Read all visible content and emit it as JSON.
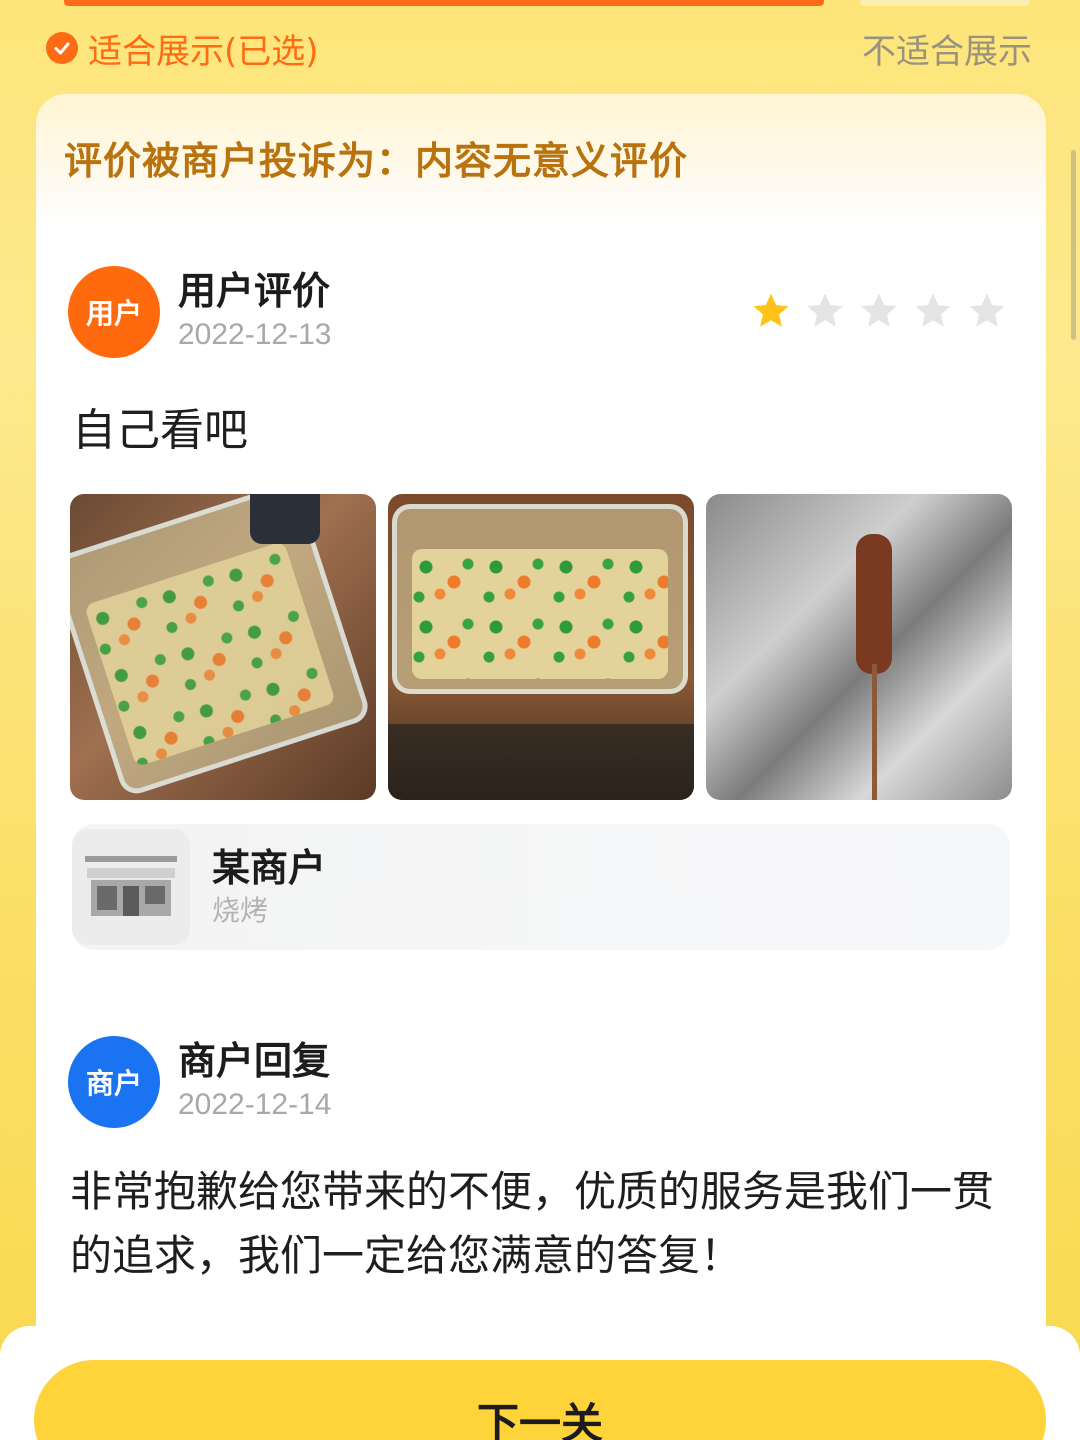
{
  "header": {
    "option_selected": "适合展示(已选)",
    "option_other": "不适合展示"
  },
  "card": {
    "complaint": "评价被商户投诉为：内容无意义评价",
    "user_review": {
      "avatar_label": "用户",
      "title": "用户评价",
      "date": "2022-12-13",
      "rating": 1,
      "rating_max": 5,
      "text": "自己看吧",
      "photos": [
        "fried-rice-container-photo",
        "fried-rice-tray-photo",
        "skewer-on-foil-photo"
      ]
    },
    "merchant": {
      "name": "某商户",
      "category": "烧烤"
    },
    "merchant_reply": {
      "avatar_label": "商户",
      "title": "商户回复",
      "date": "2022-12-14",
      "text": "非常抱歉给您带来的不便，优质的服务是我们一贯的追求，我们一定给您满意的答复！"
    }
  },
  "footer": {
    "next_label": "下一关"
  },
  "colors": {
    "accent_orange": "#ff6a14",
    "star_active": "#ffc21a",
    "star_inactive": "#e4e4e4",
    "merchant_blue": "#1a73f0",
    "button_yellow": "#ffd43a"
  }
}
